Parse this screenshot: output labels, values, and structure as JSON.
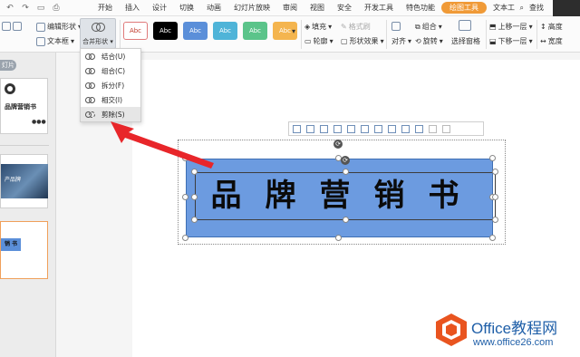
{
  "menu": {
    "items": [
      "开始",
      "插入",
      "设计",
      "切换",
      "动画",
      "幻灯片放映",
      "审阅",
      "视图",
      "安全",
      "开发工具",
      "特色功能",
      "绘图工具",
      "文本工"
    ],
    "active": "绘图工具",
    "search": "查找"
  },
  "ribbon": {
    "edit_shape": "编辑形状",
    "textbox": "文本框",
    "merge_shapes": "合并形状",
    "style_swatches": [
      {
        "label": "Abc",
        "bg": "#ffffff",
        "fg": "#c0392b",
        "border": "#e07b7b"
      },
      {
        "label": "Abc",
        "bg": "#000000",
        "fg": "#ffffff",
        "border": "#000000"
      },
      {
        "label": "Abc",
        "bg": "#5b8fd9",
        "fg": "#ffffff",
        "border": "#5b8fd9"
      },
      {
        "label": "Abc",
        "bg": "#4fb4d8",
        "fg": "#ffffff",
        "border": "#4fb4d8"
      },
      {
        "label": "Abc",
        "bg": "#5bc48a",
        "fg": "#ffffff",
        "border": "#5bc48a"
      },
      {
        "label": "Abc",
        "bg": "#f4b54f",
        "fg": "#ffffff",
        "border": "#f4b54f"
      }
    ],
    "fill": "填充",
    "format_painter": "格式刷",
    "outline": "轮廓",
    "shape_effects": "形状效果",
    "align": "对齐",
    "group": "组合",
    "rotate": "旋转",
    "selection_pane": "选择窗格",
    "bring_forward": "上移一层",
    "send_backward": "下移一层",
    "height": "高度",
    "width": "宽度"
  },
  "dropdown": {
    "items": [
      "结合(U)",
      "组合(C)",
      "拆分(F)",
      "相交(I)",
      "剪除(S)"
    ],
    "highlighted_index": 4
  },
  "slides": {
    "tab_label": "灯片",
    "thumb1_text": "品牌营销书",
    "thumb1_dots": "●●●",
    "thumb2_text": "产品牌",
    "thumb3_text": "销 书"
  },
  "shape": {
    "text": "品牌营销书",
    "fill": "#6c9be0"
  },
  "watermark": {
    "line1": "Office教程网",
    "line2": "www.office26.com"
  }
}
